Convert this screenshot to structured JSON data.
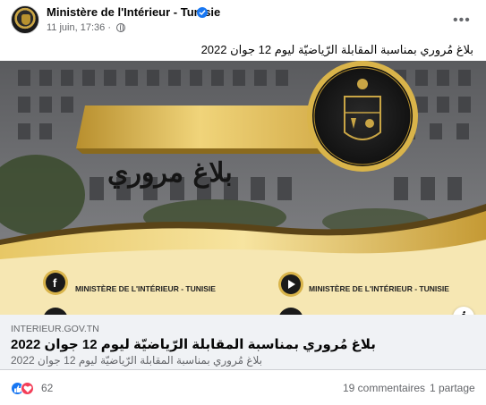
{
  "post": {
    "author": "Ministère de l'Intérieur - Tunisie",
    "verified_icon": "verified-badge-icon",
    "timestamp": "11 juin, 17:36",
    "audience_icon": "globe-icon",
    "more_icon": "more-options-icon",
    "caption": "بلاغ مُروري بمناسبة المقابلة الرّياضيّة ليوم 12 جوان 2022"
  },
  "banner": {
    "headline": "بلاغ مروري",
    "social_1": "MINISTÈRE DE L'INTÉRIEUR - TUNISIE",
    "social_2": "MINISTÈRE DE L'INTÉRIEUR - TUNISIE",
    "social_icons": [
      "facebook-icon",
      "youtube-icon"
    ],
    "colors": {
      "gold": "#d9b44a",
      "dark_gold": "#8a6a1d",
      "cream": "#f6e7b3",
      "gray": "#6d6e70"
    }
  },
  "link_preview": {
    "domain": "INTERIEUR.GOV.TN",
    "title": "بلاغ مُروري بمناسبة المقابلة الرّياضيّة ليوم 12 جوان 2022",
    "description": "بلاغ مُروري بمناسبة المقابلة الرّياضيّة ليوم 12 جوان 2022"
  },
  "engagement": {
    "reaction_icons": [
      "like-icon",
      "love-icon"
    ],
    "reaction_count": "62",
    "comments": "19 commentaires",
    "shares": "1 partage"
  }
}
